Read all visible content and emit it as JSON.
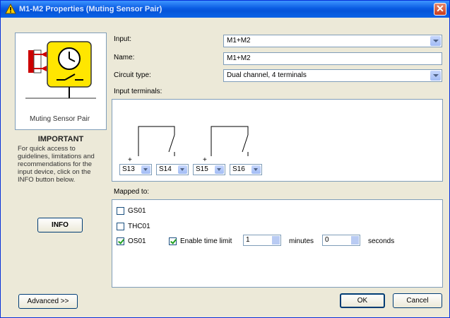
{
  "window": {
    "title": "M1-M2 Properties (Muting Sensor Pair)",
    "close_symbol": "✕"
  },
  "device": {
    "caption": "Muting Sensor Pair"
  },
  "important": {
    "heading": "IMPORTANT",
    "text": "For quick access to guidelines, limitations and recommendations for the input device, click on the INFO button below.",
    "info_button": "INFO"
  },
  "form": {
    "input_label": "Input:",
    "input_value": "M1+M2",
    "name_label": "Name:",
    "name_value": "M1+M2",
    "circuit_label": "Circuit type:",
    "circuit_value": "Dual channel, 4 terminals",
    "terminals_label": "Input terminals:"
  },
  "terminals": [
    {
      "value": "S13",
      "mark": "+"
    },
    {
      "value": "S14",
      "mark": ""
    },
    {
      "value": "S15",
      "mark": "+"
    },
    {
      "value": "S16",
      "mark": ""
    }
  ],
  "mapped": {
    "label": "Mapped to:",
    "items": [
      {
        "name": "GS01",
        "checked": false
      },
      {
        "name": "THC01",
        "checked": false
      },
      {
        "name": "OS01",
        "checked": true
      }
    ],
    "time_limit_label": "Enable time limit",
    "time_limit_checked": true,
    "minutes_value": "1",
    "minutes_label": "minutes",
    "seconds_value": "0",
    "seconds_label": "seconds"
  },
  "buttons": {
    "advanced": "Advanced >>",
    "ok": "OK",
    "cancel": "Cancel"
  },
  "colors": {
    "title_bar": "#0a5ce3",
    "dialog_bg": "#ece9d8",
    "device_yellow": "#ffe600",
    "device_red": "#cc0000"
  },
  "icons": [
    "warning-icon",
    "close-icon",
    "muting-sensor-pair-icon",
    "dropdown-arrow-icon",
    "checkbox-icon",
    "spinner-icon"
  ]
}
